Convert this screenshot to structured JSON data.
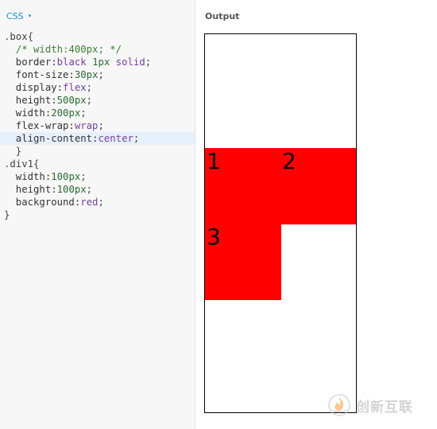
{
  "editor": {
    "lang_label": "CSS",
    "caret": "▾",
    "lines": [
      [
        {
          "t": ".box",
          "c": "sel"
        },
        {
          "t": "{",
          "c": "punc"
        }
      ],
      [
        {
          "t": "  ",
          "c": "punc"
        },
        {
          "t": "/* width:400px; */",
          "c": "comment"
        }
      ],
      [
        {
          "t": "  border:",
          "c": "prop"
        },
        {
          "t": "black",
          "c": "kw"
        },
        {
          "t": " ",
          "c": "punc"
        },
        {
          "t": "1px",
          "c": "num"
        },
        {
          "t": " ",
          "c": "punc"
        },
        {
          "t": "solid",
          "c": "kw"
        },
        {
          "t": ";",
          "c": "punc"
        }
      ],
      [
        {
          "t": "  font-size:",
          "c": "prop"
        },
        {
          "t": "30px",
          "c": "num"
        },
        {
          "t": ";",
          "c": "punc"
        }
      ],
      [
        {
          "t": "  display:",
          "c": "prop"
        },
        {
          "t": "flex",
          "c": "kw"
        },
        {
          "t": ";",
          "c": "punc"
        }
      ],
      [
        {
          "t": "  height:",
          "c": "prop"
        },
        {
          "t": "500px",
          "c": "num"
        },
        {
          "t": ";",
          "c": "punc"
        }
      ],
      [
        {
          "t": "  width:",
          "c": "prop"
        },
        {
          "t": "200px",
          "c": "num"
        },
        {
          "t": ";",
          "c": "punc"
        }
      ],
      [
        {
          "t": "  flex-wrap:",
          "c": "prop"
        },
        {
          "t": "wrap",
          "c": "kw"
        },
        {
          "t": ";",
          "c": "punc"
        }
      ],
      [
        {
          "t": "  align-content:",
          "c": "prop"
        },
        {
          "t": "center",
          "c": "kw"
        },
        {
          "t": ";",
          "c": "punc"
        }
      ],
      [
        {
          "t": "  }",
          "c": "punc"
        }
      ],
      [
        {
          "t": ".div1",
          "c": "sel"
        },
        {
          "t": "{",
          "c": "punc"
        }
      ],
      [
        {
          "t": "  width:",
          "c": "prop"
        },
        {
          "t": "100px",
          "c": "num"
        },
        {
          "t": ";",
          "c": "punc"
        }
      ],
      [
        {
          "t": "  height:",
          "c": "prop"
        },
        {
          "t": "100px",
          "c": "num"
        },
        {
          "t": ";",
          "c": "punc"
        }
      ],
      [
        {
          "t": "  background:",
          "c": "prop"
        },
        {
          "t": "red",
          "c": "kw"
        },
        {
          "t": ";",
          "c": "punc"
        }
      ],
      [
        {
          "t": "}",
          "c": "punc"
        }
      ]
    ],
    "active_line": 8
  },
  "output": {
    "title": "Output",
    "items": [
      "1",
      "2",
      "3"
    ],
    "item_color": "#ff0000",
    "border_color": "#000000"
  },
  "watermark": {
    "text": "创新互联",
    "logo": "flame-logo-icon"
  }
}
